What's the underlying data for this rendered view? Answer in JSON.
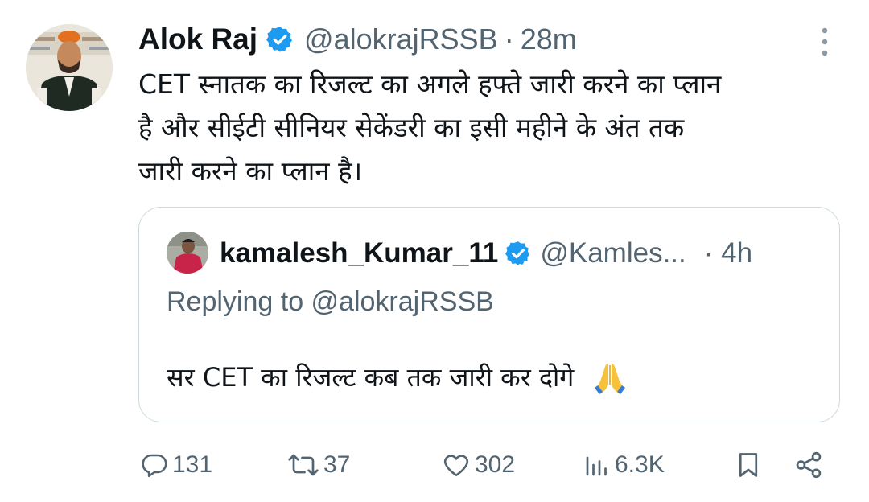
{
  "tweet": {
    "author_name": "Alok Raj",
    "handle": "@alokrajRSSB",
    "separator": "·",
    "time": "28m",
    "text_lines": [
      "CET स्नातक का रिजल्ट का अगले हफ्ते जारी करने का प्लान",
      "है और सीईटी सीनियर सेकेंडरी का इसी महीने के अंत तक",
      "जारी करने का प्लान  है।"
    ],
    "avatar_icon": "profile-photo-man-in-saffron-cap",
    "verified_icon": "verified-badge-icon",
    "more_icon": "more-vertical-icon"
  },
  "quote": {
    "author_name": "kamalesh_Kumar_11",
    "handle": "@Kamles...",
    "time": "· 4h",
    "replying_to": "Replying to @alokrajRSSB",
    "text": "सर CET का रिजल्ट कब तक जारी कर दोगे",
    "emoji": "folded-hands-emoji"
  },
  "actions": {
    "replies": "131",
    "reposts": "37",
    "likes": "302",
    "views": "6.3K",
    "icons": [
      "reply-icon",
      "repost-icon",
      "like-icon",
      "views-icon",
      "bookmark-icon",
      "share-icon"
    ]
  },
  "colors": {
    "text_primary": "#0f1419",
    "text_secondary": "#536471",
    "verified_blue": "#1d9bf0",
    "border": "#cfd9de"
  }
}
